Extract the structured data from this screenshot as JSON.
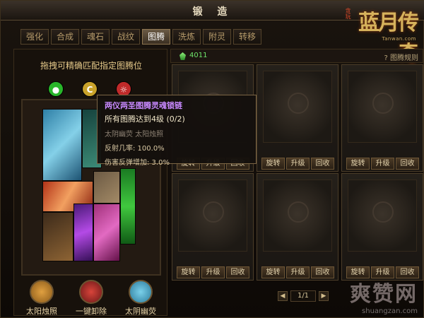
{
  "window": {
    "title": "锻 造"
  },
  "logo": {
    "main": "蓝月传奇",
    "prefix": "贪玩",
    "url": "Tanwan.com"
  },
  "tabs": [
    {
      "label": "强化"
    },
    {
      "label": "合成"
    },
    {
      "label": "魂石"
    },
    {
      "label": "战纹"
    },
    {
      "label": "图腾",
      "active": true
    },
    {
      "label": "洗炼"
    },
    {
      "label": "附灵"
    },
    {
      "label": "转移"
    }
  ],
  "left": {
    "hint": "拖拽可精确匹配指定图腾位",
    "gems": [
      {
        "glyph": "●",
        "color": "#29b62a"
      },
      {
        "glyph": "C",
        "color": "#c9a22a"
      },
      {
        "glyph": "☼",
        "color": "#c02a2a"
      }
    ],
    "buttons": [
      {
        "label": "太阳烛照",
        "icon": "sun-icon",
        "color": "#8a5a1a"
      },
      {
        "label": "一键卸除",
        "icon": "remove-all-icon",
        "color": "#8a2020"
      },
      {
        "label": "太阴幽荧",
        "icon": "moon-icon",
        "color": "#2c7a9a"
      }
    ]
  },
  "right": {
    "crystal_count": "4011",
    "rules": "? 图腾规则",
    "slot_buttons": [
      "旋转",
      "升级",
      "回收"
    ],
    "slots": 6,
    "pager": {
      "prev": "◀",
      "next": "▶",
      "page": "1/1"
    }
  },
  "tooltip": {
    "title": "两仪两圣图腾灵魂锁链",
    "requirement": "所有图腾达到4级 (0/2)",
    "items": "太阴幽荧  太阳烛照",
    "stats": [
      "反射几率:  100.0%",
      "伤害反弹增加:  3.0%"
    ]
  },
  "watermark": {
    "main": "爽赞网",
    "sub": "shuangzan.com"
  }
}
